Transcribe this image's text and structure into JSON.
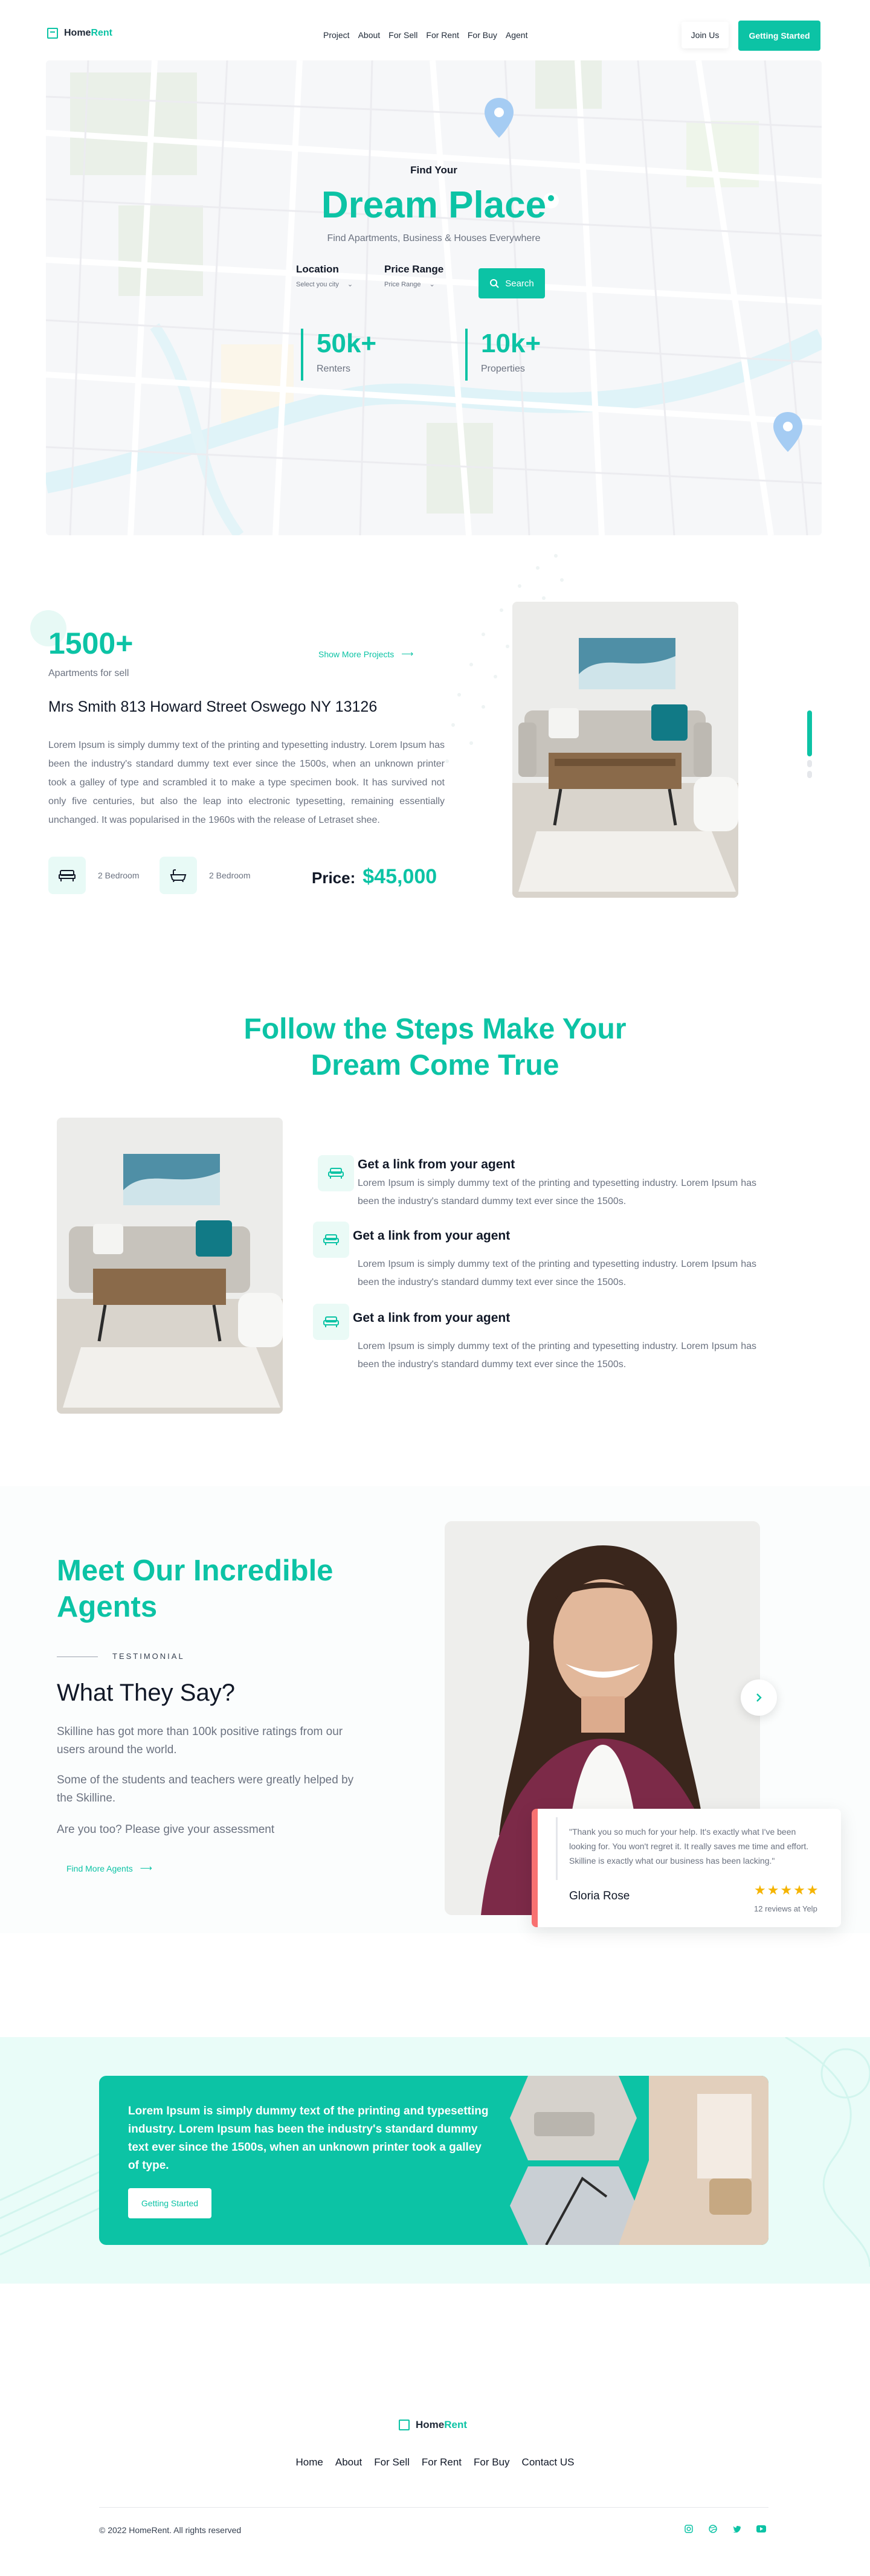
{
  "brand": {
    "name_part1": "Home",
    "name_part2": "Rent"
  },
  "nav": {
    "items": [
      "Project",
      "About",
      "For Sell",
      "For Rent",
      "For Buy",
      "Agent"
    ],
    "join_label": "Join Us",
    "start_label": "Getting Started"
  },
  "hero": {
    "eyebrow": "Find Your",
    "title": "Dream Place",
    "subtitle": "Find Apartments, Business & Houses Everywhere",
    "location_label": "Location",
    "location_value": "Select you city",
    "price_label": "Price Range",
    "price_value": "Price Range",
    "search_label": "Search",
    "stats": [
      {
        "value": "50k+",
        "label": "Renters"
      },
      {
        "value": "10k+",
        "label": "Properties"
      }
    ]
  },
  "project": {
    "count": "1500+",
    "count_label": "Apartments for sell",
    "show_more": "Show More Projects",
    "title": "Mrs Smith 813 Howard Street Oswego NY 13126",
    "description": "Lorem Ipsum is simply dummy text of the printing and typesetting industry. Lorem Ipsum has been the industry's standard dummy text ever since the 1500s, when an unknown printer took a galley of type and scrambled it to make a type specimen book. It has survived not only five centuries, but also the leap into electronic typesetting, remaining essentially unchanged. It was popularised in the 1960s with the release of Letraset shee.",
    "features": [
      "2 Bedroom",
      "2 Bedroom"
    ],
    "price_label": "Price:",
    "price_value": "$45,000"
  },
  "steps": {
    "title_line1": "Follow the Steps Make Your",
    "title_line2": "Dream Come True",
    "items": [
      {
        "title": "Get a link from your agent",
        "text": "Lorem Ipsum is simply dummy text of the printing and typesetting industry. Lorem Ipsum has been the industry's standard dummy text ever since the 1500s."
      },
      {
        "title": "Get a link from your agent",
        "text": "Lorem Ipsum is simply dummy text of the printing and typesetting industry. Lorem Ipsum has been the industry's standard dummy text ever since the 1500s."
      },
      {
        "title": "Get a link from your agent",
        "text": "Lorem Ipsum is simply dummy text of the printing and typesetting industry. Lorem Ipsum has been the industry's standard dummy text ever since the 1500s."
      }
    ]
  },
  "agents": {
    "title_line1": "Meet Our Incredible",
    "title_line2": "Agents",
    "eyebrow": "TESTIMONIAL",
    "heading": "What They Say?",
    "para1": "Skilline has got more than 100k positive ratings from our users around the world.",
    "para2": "Some of the students and teachers were greatly helped by the Skilline.",
    "para3": "Are you too? Please give your assessment",
    "link": "Find More Agents",
    "quote": "\"Thank you so much for your help. It's exactly what I've been looking for. You won't regret it. It really saves me time and effort. Skilline is exactly what our business has been lacking.\"",
    "quote_name": "Gloria Rose",
    "stars": "★★★★★",
    "reviews": "12 reviews at Yelp"
  },
  "cta": {
    "text": "Lorem Ipsum is simply dummy text of the printing and typesetting industry. Lorem Ipsum has been the industry's standard dummy text ever since the 1500s, when an unknown printer took a galley of type.",
    "button": "Getting Started"
  },
  "footer": {
    "menu": [
      "Home",
      "About",
      "For Sell",
      "For Rent",
      "For Buy",
      "Contact US"
    ],
    "copyright": "© 2022 HomeRent. All rights reserved",
    "socials": [
      "instagram-icon",
      "dribbble-icon",
      "twitter-icon",
      "youtube-icon"
    ]
  },
  "colors": {
    "accent": "#0cc3a5",
    "quote_border": "#f87171",
    "star": "#f5b400"
  }
}
